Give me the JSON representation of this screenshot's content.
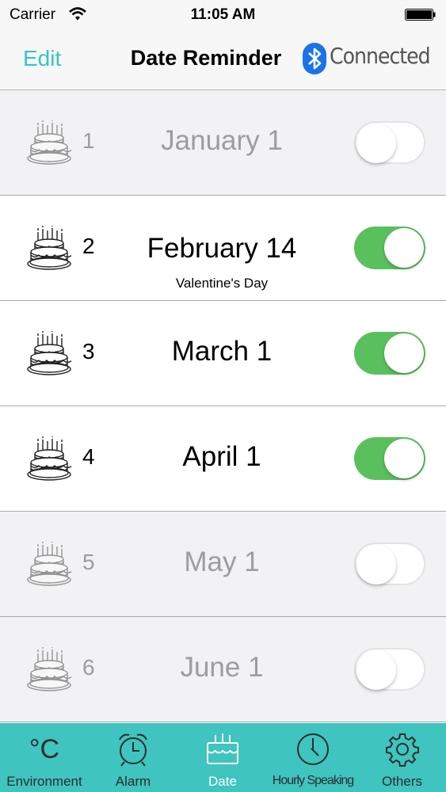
{
  "status_bar": {
    "carrier": "Carrier",
    "time": "11:05 AM"
  },
  "nav": {
    "edit_label": "Edit",
    "title": "Date Reminder",
    "connection_status": "Connected"
  },
  "reminders": [
    {
      "index": "1",
      "date": "January 1",
      "note": "",
      "enabled": false
    },
    {
      "index": "2",
      "date": "February 14",
      "note": "Valentine's Day",
      "enabled": true
    },
    {
      "index": "3",
      "date": "March 1",
      "note": "",
      "enabled": true
    },
    {
      "index": "4",
      "date": "April 1",
      "note": "",
      "enabled": true
    },
    {
      "index": "5",
      "date": "May 1",
      "note": "",
      "enabled": false
    },
    {
      "index": "6",
      "date": "June 1",
      "note": "",
      "enabled": false
    }
  ],
  "tabs": [
    {
      "label": "Environment",
      "icon": "celsius-icon",
      "glyph": "°C",
      "active": false
    },
    {
      "label": "Alarm",
      "icon": "alarm-clock-icon",
      "active": false
    },
    {
      "label": "Date",
      "icon": "cake-icon",
      "active": true
    },
    {
      "label": "Hourly Speaking",
      "icon": "clock-icon",
      "active": false
    },
    {
      "label": "Others",
      "icon": "gear-icon",
      "active": false
    }
  ],
  "colors": {
    "accent": "#3bc3c3",
    "tab_bar": "#3fc4bf",
    "toggle_on": "#5ac05e",
    "bluetooth": "#1a73e8"
  }
}
